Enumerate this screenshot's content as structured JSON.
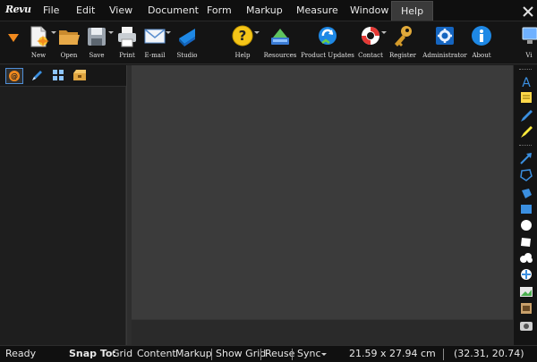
{
  "app": {
    "logo_text": "Revu"
  },
  "menu": {
    "items": [
      "File",
      "Edit",
      "View",
      "Document",
      "Form",
      "Markup",
      "Measure",
      "Window",
      "Help"
    ],
    "active": "Help"
  },
  "toolbar": {
    "new_label": "New",
    "open_label": "Open",
    "save_label": "Save",
    "print_label": "Print",
    "email_label": "E-mail",
    "studio_label": "Studio",
    "help_label": "Help",
    "resources_label": "Resources",
    "product_updates_label": "Product Updates",
    "contact_label": "Contact",
    "register_label": "Register",
    "administrator_label": "Administrator",
    "about_label": "About",
    "view_partial_label": "Vi"
  },
  "left_panel": {
    "tabs": [
      "bookmarks-tab",
      "markup-tab",
      "thumbnails-tab",
      "tool-chest-tab"
    ],
    "active_tab": "bookmarks-tab"
  },
  "status": {
    "ready": "Ready",
    "snap_to": "Snap To:",
    "grid": "Grid",
    "content": "Content",
    "markup": "Markup",
    "show_grid": "Show Grid",
    "reuse": "Reuse",
    "sync": "Sync",
    "page_size": "21.59 x 27.94 cm",
    "coords": "(32.31, 20.74)"
  },
  "colors": {
    "accent_orange": "#f28a1e",
    "accent_blue": "#1e88e5",
    "canvas": "#3b3b3b",
    "panel": "#1e1e1e"
  }
}
